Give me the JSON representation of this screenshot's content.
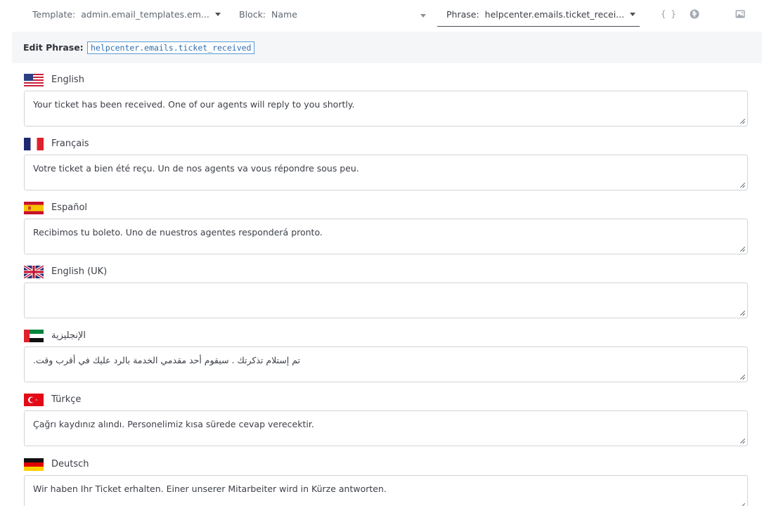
{
  "toolbar": {
    "template_label": "Template:",
    "template_value": "admin.email_templates.em...",
    "block_label": "Block:",
    "block_value": "Name",
    "phrase_label": "Phrase:",
    "phrase_value": "helpcenter.emails.ticket_recei...",
    "icons": [
      "code-braces-icon",
      "globe-icon",
      "image-icon"
    ],
    "braces_glyph": "{ }"
  },
  "edit_phrase": {
    "label": "Edit Phrase:",
    "key": "helpcenter.emails.ticket_received"
  },
  "languages": [
    {
      "name": "English",
      "flag": "us-flag-icon",
      "text": "Your ticket has been received. One of our agents will reply to you shortly."
    },
    {
      "name": "Français",
      "flag": "fr-flag-icon",
      "text": "Votre ticket a bien été reçu. Un de nos agents va vous répondre sous peu."
    },
    {
      "name": "Español",
      "flag": "es-flag-icon",
      "text": "Recibimos tu boleto. Uno de nuestros agentes responderá pronto."
    },
    {
      "name": "English (UK)",
      "flag": "uk-flag-icon",
      "text": ""
    },
    {
      "name": "الإنجليزية",
      "flag": "ae-flag-icon",
      "text": ".تم إستلام تذكرتك . سيقوم أحد مقدمي الخدمة بالرد عليك في أقرب وقت"
    },
    {
      "name": "Türkçe",
      "flag": "tr-flag-icon",
      "text": "Çağrı kaydınız alındı. Personelimiz kısa sürede cevap verecektir."
    },
    {
      "name": "Deutsch",
      "flag": "de-flag-icon",
      "text": "Wir haben Ihr Ticket erhalten. Einer unserer Mitarbeiter wird in Kürze antworten."
    }
  ],
  "colors": {
    "accent": "#2f6fb0",
    "edit_bar_bg": "#f4f6f8",
    "field_border": "#cfd4d9"
  }
}
